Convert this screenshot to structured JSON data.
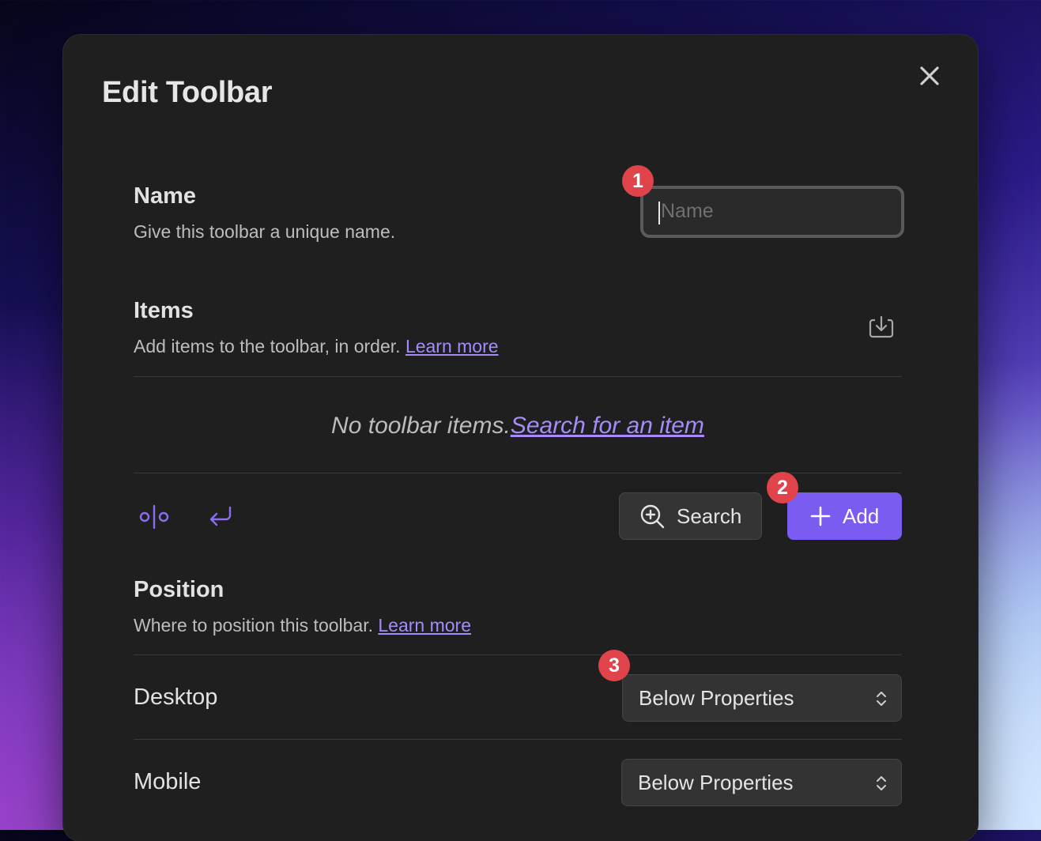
{
  "dialog": {
    "title": "Edit Toolbar"
  },
  "name_section": {
    "label": "Name",
    "description": "Give this toolbar a unique name.",
    "input_value": "",
    "input_placeholder": "Name"
  },
  "items_section": {
    "label": "Items",
    "description": "Add items to the toolbar, in order.",
    "learn_more": "Learn more",
    "empty_text": "No toolbar items.",
    "empty_link": "Search for an item",
    "search_button": "Search",
    "add_button": "Add"
  },
  "position_section": {
    "label": "Position",
    "description": "Where to position this toolbar.",
    "learn_more": "Learn more",
    "desktop_label": "Desktop",
    "desktop_value": "Below Properties",
    "mobile_label": "Mobile",
    "mobile_value": "Below Properties"
  },
  "badges": [
    "1",
    "2",
    "3"
  ],
  "colors": {
    "accent": "#7b5cf0",
    "link": "#a78bfa",
    "badge": "#e0434a",
    "panel": "#1f1f1f"
  },
  "icons": {
    "close": "close-icon",
    "export": "export-icon",
    "separator": "separator-icon",
    "line_break": "line-break-icon",
    "search": "search-plus-icon",
    "add": "plus-icon",
    "select": "chevron-up-down-icon"
  }
}
